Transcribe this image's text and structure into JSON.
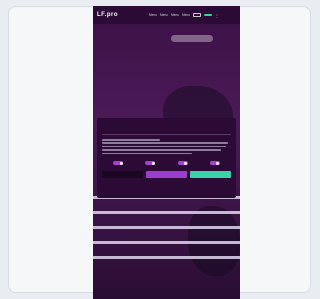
{
  "colors": {
    "accent_purple": "#9b3ed0",
    "accent_green": "#3ad2a7",
    "brand_dark": "#2b0b35"
  },
  "topbar": {
    "logo": "LF.pro",
    "links": [
      "Menu",
      "Menu",
      "Menu",
      "Menu"
    ],
    "outline_button": "",
    "cta_button": "",
    "menu_icon": "kebab-icon"
  },
  "cookie_modal": {
    "title": "",
    "close_label": "",
    "tabs": [],
    "toggles": [],
    "buttons": []
  }
}
